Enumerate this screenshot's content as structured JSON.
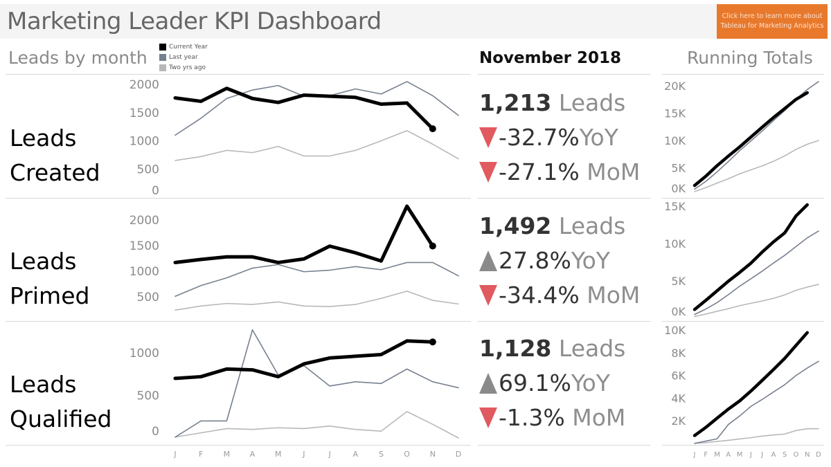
{
  "header": {
    "title": "Marketing Leader KPI Dashboard",
    "cta_line1": "Click here to learn more about",
    "cta_line2": "Tableau for Marketing Analytics",
    "cta_color": "#e8792c"
  },
  "sections": {
    "leads_by_month": "Leads by month",
    "period": "November 2018",
    "running_totals": "Running Totals"
  },
  "legend": [
    {
      "label": "Current Year",
      "color": "#000000"
    },
    {
      "label": "Last year",
      "color": "#76808e"
    },
    {
      "label": "Two yrs ago",
      "color": "#b8b8b8"
    }
  ],
  "rows": [
    {
      "label_line1": "Leads",
      "label_line2": "Created",
      "kpi": {
        "value": "1,213",
        "unit": "Leads",
        "yoy": "-32.7%",
        "yoy_label": "YoY",
        "yoy_dir": "down",
        "mom": "-27.1%",
        "mom_label": "MoM",
        "mom_dir": "down"
      }
    },
    {
      "label_line1": "Leads",
      "label_line2": "Primed",
      "kpi": {
        "value": "1,492",
        "unit": "Leads",
        "yoy": "27.8%",
        "yoy_label": "YoY",
        "yoy_dir": "up",
        "mom": "-34.4%",
        "mom_label": "MoM",
        "mom_dir": "down"
      }
    },
    {
      "label_line1": "Leads",
      "label_line2": "Qualified",
      "kpi": {
        "value": "1,128",
        "unit": "Leads",
        "yoy": "69.1%",
        "yoy_label": "YoY",
        "yoy_dir": "up",
        "mom": "-1.3%",
        "mom_label": "MoM",
        "mom_dir": "down"
      }
    }
  ],
  "colors": {
    "down": "#e05a5f",
    "up": "#8a8a8a",
    "current": "#000000",
    "last": "#76808e",
    "two": "#b8b8b8"
  },
  "chart_data": [
    {
      "type": "line",
      "title": "Leads Created by month",
      "categories": [
        "J",
        "F",
        "M",
        "A",
        "M",
        "J",
        "J",
        "A",
        "S",
        "O",
        "N",
        "D"
      ],
      "yticks": [
        0,
        500,
        1000,
        1500,
        2000
      ],
      "ylim": [
        0,
        2100
      ],
      "series": [
        {
          "name": "Current Year",
          "values": [
            1760,
            1700,
            1930,
            1750,
            1680,
            1810,
            1790,
            1770,
            1650,
            1670,
            1213,
            null
          ]
        },
        {
          "name": "Last year",
          "values": [
            1100,
            1400,
            1750,
            1900,
            1980,
            1790,
            1800,
            1920,
            1830,
            2050,
            1800,
            1450
          ]
        },
        {
          "name": "Two yrs ago",
          "values": [
            650,
            720,
            830,
            790,
            900,
            730,
            730,
            830,
            1000,
            1180,
            940,
            680
          ]
        }
      ]
    },
    {
      "type": "line",
      "title": "Leads Primed by month",
      "categories": [
        "J",
        "F",
        "M",
        "A",
        "M",
        "J",
        "J",
        "A",
        "S",
        "O",
        "N",
        "D"
      ],
      "yticks": [
        500,
        1000,
        1500,
        2000
      ],
      "ylim": [
        0,
        2300
      ],
      "series": [
        {
          "name": "Current Year",
          "values": [
            1170,
            1230,
            1280,
            1280,
            1170,
            1240,
            1490,
            1360,
            1200,
            2270,
            1492,
            null
          ]
        },
        {
          "name": "Last year",
          "values": [
            510,
            720,
            870,
            1060,
            1130,
            990,
            1020,
            1090,
            1030,
            1170,
            1170,
            910
          ]
        },
        {
          "name": "Two yrs ago",
          "values": [
            240,
            320,
            370,
            350,
            400,
            320,
            310,
            350,
            470,
            610,
            430,
            360
          ]
        }
      ]
    },
    {
      "type": "line",
      "title": "Leads Qualified by month",
      "categories": [
        "J",
        "F",
        "M",
        "A",
        "M",
        "J",
        "J",
        "A",
        "S",
        "O",
        "N",
        "D"
      ],
      "yticks": [
        0,
        500,
        1000
      ],
      "ylim": [
        0,
        1300
      ],
      "series": [
        {
          "name": "Current Year",
          "values": [
            700,
            720,
            810,
            800,
            720,
            870,
            940,
            960,
            980,
            1140,
            1128,
            null
          ]
        },
        {
          "name": "Last year",
          "values": [
            10,
            200,
            200,
            1270,
            740,
            850,
            610,
            660,
            640,
            810,
            660,
            590
          ]
        },
        {
          "name": "Two yrs ago",
          "values": [
            10,
            60,
            110,
            100,
            120,
            110,
            140,
            100,
            80,
            310,
            160,
            0
          ]
        }
      ]
    },
    {
      "type": "line",
      "title": "Leads Created running total",
      "categories": [
        "J",
        "F",
        "M",
        "A",
        "M",
        "J",
        "J",
        "A",
        "S",
        "O",
        "N",
        "D"
      ],
      "yticks": [
        0,
        5000,
        10000,
        15000,
        20000
      ],
      "ytick_labels": [
        "0K",
        "5K",
        "10K",
        "15K",
        "20K"
      ],
      "ylim": [
        0,
        21000
      ],
      "series": [
        {
          "name": "Current Year",
          "values": [
            1760,
            3460,
            5390,
            7140,
            8820,
            10630,
            12420,
            14190,
            15840,
            17510,
            18723,
            null
          ]
        },
        {
          "name": "Last year",
          "values": [
            1100,
            2500,
            4250,
            6150,
            8130,
            9920,
            11720,
            13640,
            15470,
            17520,
            19320,
            20770
          ]
        },
        {
          "name": "Two yrs ago",
          "values": [
            650,
            1370,
            2200,
            2990,
            3890,
            4620,
            5350,
            6180,
            7180,
            8360,
            9300,
            9980
          ]
        }
      ]
    },
    {
      "type": "line",
      "title": "Leads Primed running total",
      "categories": [
        "J",
        "F",
        "M",
        "A",
        "M",
        "J",
        "J",
        "A",
        "S",
        "O",
        "N",
        "D"
      ],
      "yticks": [
        0,
        5000,
        10000,
        15000
      ],
      "ytick_labels": [
        "0K",
        "5K",
        "10K",
        "15K"
      ],
      "ylim": [
        0,
        15500
      ],
      "series": [
        {
          "name": "Current Year",
          "values": [
            1170,
            2400,
            3680,
            4960,
            6130,
            7370,
            8860,
            10220,
            11420,
            13690,
            15182,
            null
          ]
        },
        {
          "name": "Last year",
          "values": [
            510,
            1230,
            2100,
            3160,
            4290,
            5280,
            6300,
            7390,
            8420,
            9590,
            10760,
            11670
          ]
        },
        {
          "name": "Two yrs ago",
          "values": [
            240,
            560,
            930,
            1280,
            1680,
            2000,
            2310,
            2660,
            3130,
            3740,
            4170,
            4530
          ]
        }
      ]
    },
    {
      "type": "line",
      "title": "Leads Qualified running total",
      "categories": [
        "J",
        "F",
        "M",
        "A",
        "M",
        "J",
        "J",
        "A",
        "S",
        "O",
        "N",
        "D"
      ],
      "yticks": [
        2000,
        4000,
        6000,
        8000,
        10000
      ],
      "ytick_labels": [
        "2K",
        "4K",
        "6K",
        "8K",
        "10K"
      ],
      "ylim": [
        0,
        10300
      ],
      "series": [
        {
          "name": "Current Year",
          "values": [
            700,
            1420,
            2230,
            3030,
            3750,
            4620,
            5560,
            6520,
            7500,
            8640,
            9768,
            null
          ]
        },
        {
          "name": "Last year",
          "values": [
            10,
            210,
            410,
            1680,
            2420,
            3270,
            3880,
            4540,
            5180,
            5990,
            6650,
            7240
          ]
        },
        {
          "name": "Two yrs ago",
          "values": [
            10,
            70,
            180,
            280,
            400,
            510,
            650,
            750,
            830,
            1140,
            1300,
            1300
          ]
        }
      ]
    }
  ]
}
